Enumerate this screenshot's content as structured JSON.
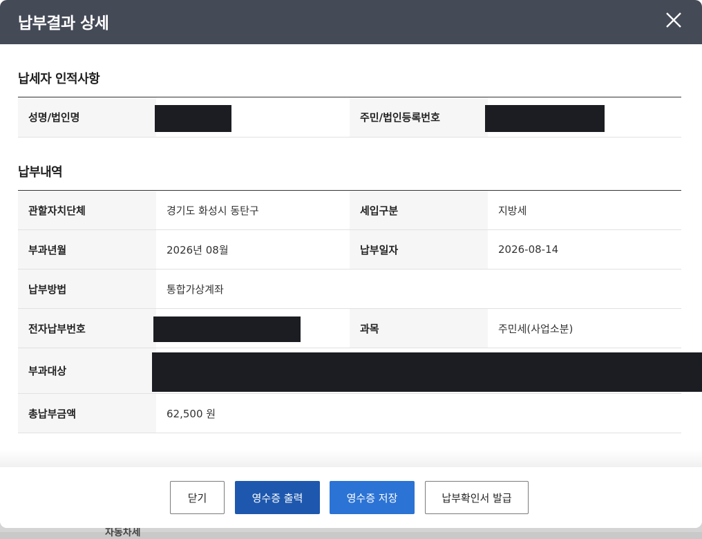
{
  "dialog": {
    "title": "납부결과 상세",
    "close_icon": "close-icon"
  },
  "taxpayer": {
    "section_title": "납세자 인적사항",
    "name_label": "성명/법인명",
    "id_label": "주민/법인등록번호"
  },
  "payment": {
    "section_title": "납부내역",
    "rows": {
      "authority_label": "관할자치단체",
      "authority_value": "경기도 화성시 동탄구",
      "revenue_type_label": "세입구분",
      "revenue_type_value": "지방세",
      "levy_month_label": "부과년월",
      "levy_month_value": "2026년 08월",
      "pay_date_label": "납부일자",
      "pay_date_value": "2026-08-14",
      "pay_method_label": "납부방법",
      "pay_method_value": "통합가상계좌",
      "e_pay_no_label": "전자납부번호",
      "tax_item_label": "과목",
      "tax_item_value": "주민세(사업소분)",
      "target_label": "부과대상",
      "total_label": "총납부금액",
      "total_value": "62,500 원"
    }
  },
  "buttons": {
    "close": "닫기",
    "print_receipt": "영수증 출력",
    "save_receipt": "영수증 저장",
    "issue_confirmation": "납부확인서 발급"
  },
  "background": {
    "partial_text": "자동차세"
  },
  "colors": {
    "header_bg": "#454a57",
    "primary_dark": "#1e58ae",
    "primary": "#2b73d4",
    "redaction": "#1c1d22"
  }
}
